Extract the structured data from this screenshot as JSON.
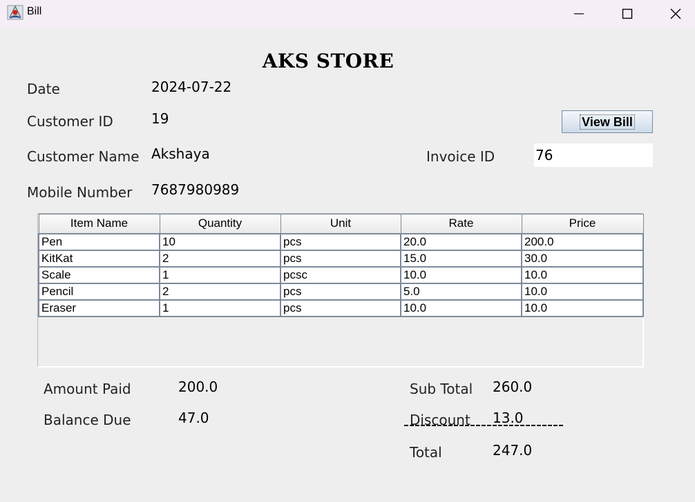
{
  "window": {
    "title": "Bill"
  },
  "store_name": "AKS STORE",
  "fields": {
    "date_label": "Date",
    "date_value": "2024-07-22",
    "customer_id_label": "Customer ID",
    "customer_id_value": "19",
    "customer_name_label": "Customer Name",
    "customer_name_value": "Akshaya",
    "mobile_label": "Mobile Number",
    "mobile_value": "7687980989",
    "invoice_id_label": "Invoice ID",
    "invoice_id_value": "76"
  },
  "buttons": {
    "view_bill": "View Bill"
  },
  "table": {
    "columns": [
      "Item Name",
      "Quantity",
      "Unit",
      "Rate",
      "Price"
    ],
    "rows": [
      [
        "Pen",
        "10",
        "pcs",
        "20.0",
        "200.0"
      ],
      [
        "KitKat",
        "2",
        "pcs",
        "15.0",
        "30.0"
      ],
      [
        "Scale",
        "1",
        "pcsc",
        "10.0",
        "10.0"
      ],
      [
        "Pencil",
        "2",
        "pcs",
        "5.0",
        "10.0"
      ],
      [
        "Eraser",
        "1",
        "pcs",
        "10.0",
        "10.0"
      ]
    ]
  },
  "summary": {
    "amount_paid_label": "Amount Paid",
    "amount_paid_value": "200.0",
    "balance_due_label": "Balance Due",
    "balance_due_value": "47.0",
    "sub_total_label": "Sub Total",
    "sub_total_value": "260.0",
    "discount_label": "Discount",
    "discount_value": "13.0",
    "total_label": "Total",
    "total_value": "247.0"
  }
}
